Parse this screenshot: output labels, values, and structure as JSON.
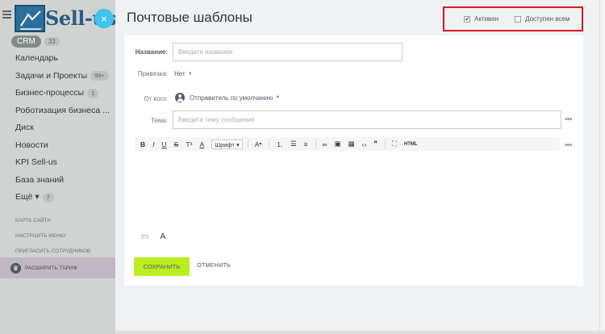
{
  "sidebar": {
    "logo_text": "Sell-us",
    "crm": {
      "label": "CRM",
      "count": "33"
    },
    "items": [
      {
        "label": "Календарь",
        "badge": ""
      },
      {
        "label": "Задачи и Проекты",
        "badge": "99+"
      },
      {
        "label": "Бизнес-процессы",
        "badge": "1"
      },
      {
        "label": "Роботизация бизнеса ...",
        "badge": ""
      },
      {
        "label": "Диск",
        "badge": ""
      },
      {
        "label": "Новости",
        "badge": ""
      },
      {
        "label": "KPI Sell-us",
        "badge": ""
      },
      {
        "label": "База знаний",
        "badge": ""
      },
      {
        "label": "Ещё ▾",
        "badge": "7"
      }
    ],
    "links": [
      "КАРТА САЙТА",
      "НАСТРОИТЬ МЕНЮ",
      "ПРИГЛАСИТЬ СОТРУДНИКОВ"
    ],
    "tariff_label": "РАСШИРИТЬ ТАРИФ"
  },
  "close_icon": "×",
  "panel": {
    "title": "Почтовые шаблоны",
    "flags": {
      "active_label": "Активен",
      "active_checked": true,
      "shared_label": "Доступен всем",
      "shared_checked": false
    },
    "form": {
      "name_label": "Название:",
      "name_placeholder": "Введите название",
      "binding_label": "Привязка:",
      "binding_value": "Нет",
      "from_label": "От кого:",
      "from_value": "Отправитель по умолчанию",
      "subject_label": "Тема:",
      "subject_placeholder": "Введите тему сообщения",
      "more_icon": "•••"
    },
    "toolbar": {
      "bold": "B",
      "italic": "I",
      "underline": "U",
      "strike": "S",
      "clear": "T",
      "color": "A",
      "font": "Шрифт",
      "size": "A",
      "tools": [
        "link-icon",
        "image-icon",
        "table-icon",
        "code-icon",
        "quote-icon"
      ],
      "fullscreen": "⛶",
      "html": "HTML"
    },
    "editor_icons": [
      "attachment-icon",
      "text-format-icon"
    ],
    "save_label": "СОХРАНИТЬ",
    "cancel_label": "ОТМЕНИТЬ"
  }
}
